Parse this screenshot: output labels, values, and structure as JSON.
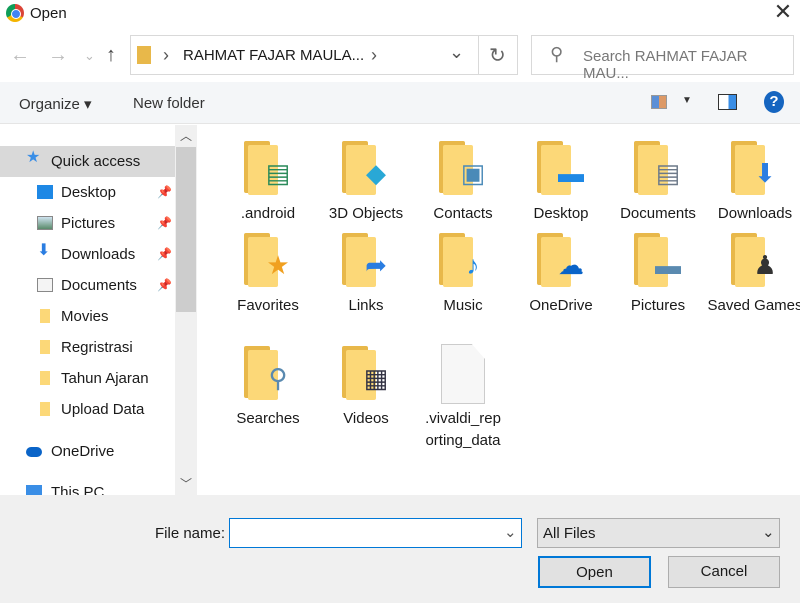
{
  "window": {
    "title": "Open",
    "close": "✕"
  },
  "nav": {
    "back": "←",
    "forward": "→",
    "recent": "⌄",
    "up": "↑"
  },
  "address": {
    "path": "RAHMAT FAJAR MAULA...",
    "chev": "›",
    "dropdown": "⌄",
    "refresh": "↻"
  },
  "search": {
    "placeholder": "Search RAHMAT FAJAR MAU..."
  },
  "toolbar": {
    "organize": "Organize ▾",
    "new_folder": "New folder",
    "help": "?"
  },
  "sidebar": {
    "items": [
      {
        "label": "Quick access",
        "icon": "star-icon",
        "pinned": false,
        "selected": true,
        "indent": 0
      },
      {
        "label": "Desktop",
        "icon": "desktop-icon",
        "pinned": true,
        "indent": 1
      },
      {
        "label": "Pictures",
        "icon": "pictures-icon",
        "pinned": true,
        "indent": 1
      },
      {
        "label": "Downloads",
        "icon": "download-icon",
        "pinned": true,
        "indent": 1
      },
      {
        "label": "Documents",
        "icon": "documents-icon",
        "pinned": true,
        "indent": 1
      },
      {
        "label": "Movies",
        "icon": "folder-icon",
        "pinned": false,
        "indent": 1
      },
      {
        "label": "Regristrasi",
        "icon": "folder-icon",
        "pinned": false,
        "indent": 1
      },
      {
        "label": "Tahun Ajaran",
        "icon": "folder-icon",
        "pinned": false,
        "indent": 1
      },
      {
        "label": "Upload Data",
        "icon": "folder-icon",
        "pinned": false,
        "indent": 1
      },
      {
        "label": "OneDrive",
        "icon": "cloud-icon",
        "pinned": false,
        "indent": 0
      },
      {
        "label": "This PC",
        "icon": "computer-icon",
        "pinned": false,
        "indent": 0
      }
    ]
  },
  "files": [
    {
      "label": ".android",
      "icon": "android-folder-icon",
      "glyph": "▤",
      "color": "#2a8a5a"
    },
    {
      "label": "3D Objects",
      "icon": "3d-objects-icon",
      "glyph": "◆",
      "color": "#29a8d6"
    },
    {
      "label": "Contacts",
      "icon": "contacts-icon",
      "glyph": "▣",
      "color": "#4a8ab8"
    },
    {
      "label": "Desktop",
      "icon": "desktop-folder-icon",
      "glyph": "▬",
      "color": "#1e88e5"
    },
    {
      "label": "Documents",
      "icon": "documents-folder-icon",
      "glyph": "▤",
      "color": "#6d7a8a"
    },
    {
      "label": "Downloads",
      "icon": "downloads-folder-icon",
      "glyph": "⬇",
      "color": "#2a7de1"
    },
    {
      "label": "Favorites",
      "icon": "favorites-icon",
      "glyph": "★",
      "color": "#f0a020"
    },
    {
      "label": "Links",
      "icon": "links-icon",
      "glyph": "➦",
      "color": "#2a7de1"
    },
    {
      "label": "Music",
      "icon": "music-icon",
      "glyph": "♪",
      "color": "#1e88e5"
    },
    {
      "label": "OneDrive",
      "icon": "onedrive-folder-icon",
      "glyph": "☁",
      "color": "#0a64c8"
    },
    {
      "label": "Pictures",
      "icon": "pictures-folder-icon",
      "glyph": "▬",
      "color": "#5a8ab0"
    },
    {
      "label": "Saved Games",
      "icon": "saved-games-icon",
      "glyph": "♟",
      "color": "#333"
    },
    {
      "label": "Searches",
      "icon": "searches-icon",
      "glyph": "⚲",
      "color": "#5a8ab0"
    },
    {
      "label": "Videos",
      "icon": "videos-icon",
      "glyph": "▦",
      "color": "#334"
    },
    {
      "label": ".vivaldi_reporting_data",
      "icon": "file-icon",
      "type": "file"
    }
  ],
  "footer": {
    "file_name_label": "File name:",
    "file_name_value": "",
    "file_type": "All Files",
    "open": "Open",
    "cancel": "Cancel"
  }
}
